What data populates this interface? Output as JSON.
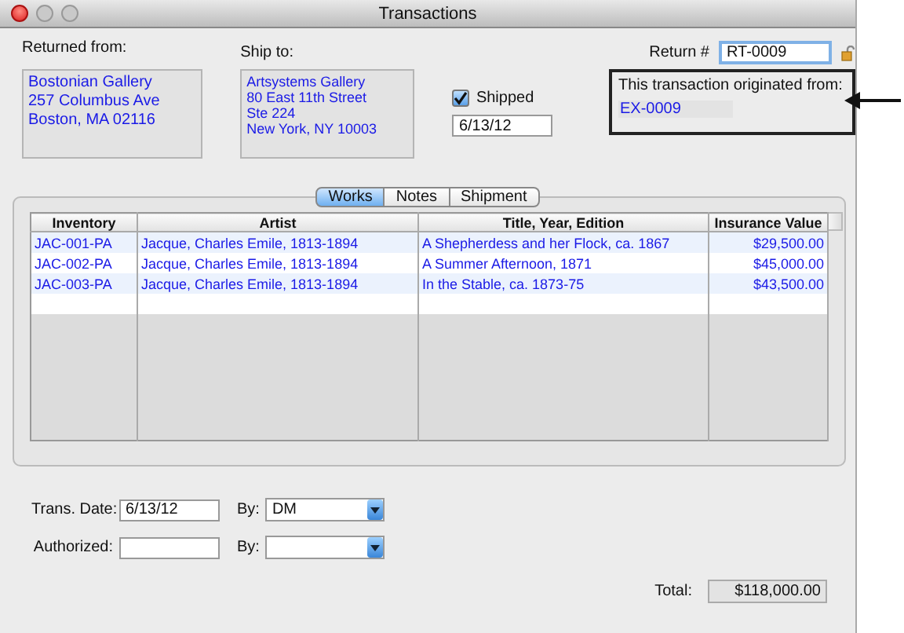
{
  "window": {
    "title": "Transactions"
  },
  "returned_from": {
    "label": "Returned from:",
    "lines": [
      "Bostonian Gallery",
      "257 Columbus Ave",
      "Boston, MA 02116"
    ]
  },
  "ship_to": {
    "label": "Ship to:",
    "lines": [
      "Artsystems Gallery",
      "80 East 11th Street",
      "Ste 224",
      "New York, NY 10003"
    ]
  },
  "shipped": {
    "label": "Shipped",
    "checked": true,
    "date": "6/13/12"
  },
  "return_number": {
    "label": "Return #",
    "value": "RT-0009"
  },
  "origin": {
    "label": "This transaction originated from:",
    "link": "EX-0009"
  },
  "tabs": [
    {
      "label": "Works",
      "selected": true
    },
    {
      "label": "Notes",
      "selected": false
    },
    {
      "label": "Shipment",
      "selected": false
    }
  ],
  "table": {
    "columns": [
      "Inventory",
      "Artist",
      "Title, Year, Edition",
      "Insurance Value"
    ],
    "rows": [
      [
        "JAC-001-PA",
        "Jacque, Charles Emile, 1813-1894",
        "A Shepherdess and her Flock, ca. 1867",
        "$29,500.00"
      ],
      [
        "JAC-002-PA",
        "Jacque, Charles Emile, 1813-1894",
        "A Summer Afternoon, 1871",
        "$45,000.00"
      ],
      [
        "JAC-003-PA",
        "Jacque, Charles Emile, 1813-1894",
        "In the Stable, ca. 1873-75",
        "$43,500.00"
      ]
    ]
  },
  "trans_date": {
    "label": "Trans. Date:",
    "value": "6/13/12",
    "by_label": "By:",
    "by_value": "DM"
  },
  "authorized": {
    "label": "Authorized:",
    "by_label": "By:"
  },
  "total": {
    "label": "Total:",
    "value": "$118,000.00"
  }
}
